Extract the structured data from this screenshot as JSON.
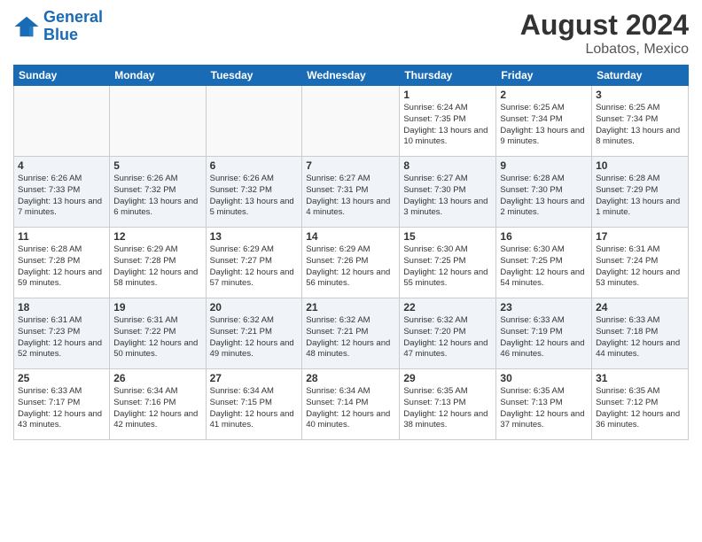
{
  "header": {
    "logo_line1": "General",
    "logo_line2": "Blue",
    "month_year": "August 2024",
    "location": "Lobatos, Mexico"
  },
  "days_of_week": [
    "Sunday",
    "Monday",
    "Tuesday",
    "Wednesday",
    "Thursday",
    "Friday",
    "Saturday"
  ],
  "weeks": [
    [
      {
        "day": "",
        "info": ""
      },
      {
        "day": "",
        "info": ""
      },
      {
        "day": "",
        "info": ""
      },
      {
        "day": "",
        "info": ""
      },
      {
        "day": "1",
        "info": "Sunrise: 6:24 AM\nSunset: 7:35 PM\nDaylight: 13 hours\nand 10 minutes."
      },
      {
        "day": "2",
        "info": "Sunrise: 6:25 AM\nSunset: 7:34 PM\nDaylight: 13 hours\nand 9 minutes."
      },
      {
        "day": "3",
        "info": "Sunrise: 6:25 AM\nSunset: 7:34 PM\nDaylight: 13 hours\nand 8 minutes."
      }
    ],
    [
      {
        "day": "4",
        "info": "Sunrise: 6:26 AM\nSunset: 7:33 PM\nDaylight: 13 hours\nand 7 minutes."
      },
      {
        "day": "5",
        "info": "Sunrise: 6:26 AM\nSunset: 7:32 PM\nDaylight: 13 hours\nand 6 minutes."
      },
      {
        "day": "6",
        "info": "Sunrise: 6:26 AM\nSunset: 7:32 PM\nDaylight: 13 hours\nand 5 minutes."
      },
      {
        "day": "7",
        "info": "Sunrise: 6:27 AM\nSunset: 7:31 PM\nDaylight: 13 hours\nand 4 minutes."
      },
      {
        "day": "8",
        "info": "Sunrise: 6:27 AM\nSunset: 7:30 PM\nDaylight: 13 hours\nand 3 minutes."
      },
      {
        "day": "9",
        "info": "Sunrise: 6:28 AM\nSunset: 7:30 PM\nDaylight: 13 hours\nand 2 minutes."
      },
      {
        "day": "10",
        "info": "Sunrise: 6:28 AM\nSunset: 7:29 PM\nDaylight: 13 hours\nand 1 minute."
      }
    ],
    [
      {
        "day": "11",
        "info": "Sunrise: 6:28 AM\nSunset: 7:28 PM\nDaylight: 12 hours\nand 59 minutes."
      },
      {
        "day": "12",
        "info": "Sunrise: 6:29 AM\nSunset: 7:28 PM\nDaylight: 12 hours\nand 58 minutes."
      },
      {
        "day": "13",
        "info": "Sunrise: 6:29 AM\nSunset: 7:27 PM\nDaylight: 12 hours\nand 57 minutes."
      },
      {
        "day": "14",
        "info": "Sunrise: 6:29 AM\nSunset: 7:26 PM\nDaylight: 12 hours\nand 56 minutes."
      },
      {
        "day": "15",
        "info": "Sunrise: 6:30 AM\nSunset: 7:25 PM\nDaylight: 12 hours\nand 55 minutes."
      },
      {
        "day": "16",
        "info": "Sunrise: 6:30 AM\nSunset: 7:25 PM\nDaylight: 12 hours\nand 54 minutes."
      },
      {
        "day": "17",
        "info": "Sunrise: 6:31 AM\nSunset: 7:24 PM\nDaylight: 12 hours\nand 53 minutes."
      }
    ],
    [
      {
        "day": "18",
        "info": "Sunrise: 6:31 AM\nSunset: 7:23 PM\nDaylight: 12 hours\nand 52 minutes."
      },
      {
        "day": "19",
        "info": "Sunrise: 6:31 AM\nSunset: 7:22 PM\nDaylight: 12 hours\nand 50 minutes."
      },
      {
        "day": "20",
        "info": "Sunrise: 6:32 AM\nSunset: 7:21 PM\nDaylight: 12 hours\nand 49 minutes."
      },
      {
        "day": "21",
        "info": "Sunrise: 6:32 AM\nSunset: 7:21 PM\nDaylight: 12 hours\nand 48 minutes."
      },
      {
        "day": "22",
        "info": "Sunrise: 6:32 AM\nSunset: 7:20 PM\nDaylight: 12 hours\nand 47 minutes."
      },
      {
        "day": "23",
        "info": "Sunrise: 6:33 AM\nSunset: 7:19 PM\nDaylight: 12 hours\nand 46 minutes."
      },
      {
        "day": "24",
        "info": "Sunrise: 6:33 AM\nSunset: 7:18 PM\nDaylight: 12 hours\nand 44 minutes."
      }
    ],
    [
      {
        "day": "25",
        "info": "Sunrise: 6:33 AM\nSunset: 7:17 PM\nDaylight: 12 hours\nand 43 minutes."
      },
      {
        "day": "26",
        "info": "Sunrise: 6:34 AM\nSunset: 7:16 PM\nDaylight: 12 hours\nand 42 minutes."
      },
      {
        "day": "27",
        "info": "Sunrise: 6:34 AM\nSunset: 7:15 PM\nDaylight: 12 hours\nand 41 minutes."
      },
      {
        "day": "28",
        "info": "Sunrise: 6:34 AM\nSunset: 7:14 PM\nDaylight: 12 hours\nand 40 minutes."
      },
      {
        "day": "29",
        "info": "Sunrise: 6:35 AM\nSunset: 7:13 PM\nDaylight: 12 hours\nand 38 minutes."
      },
      {
        "day": "30",
        "info": "Sunrise: 6:35 AM\nSunset: 7:13 PM\nDaylight: 12 hours\nand 37 minutes."
      },
      {
        "day": "31",
        "info": "Sunrise: 6:35 AM\nSunset: 7:12 PM\nDaylight: 12 hours\nand 36 minutes."
      }
    ]
  ]
}
